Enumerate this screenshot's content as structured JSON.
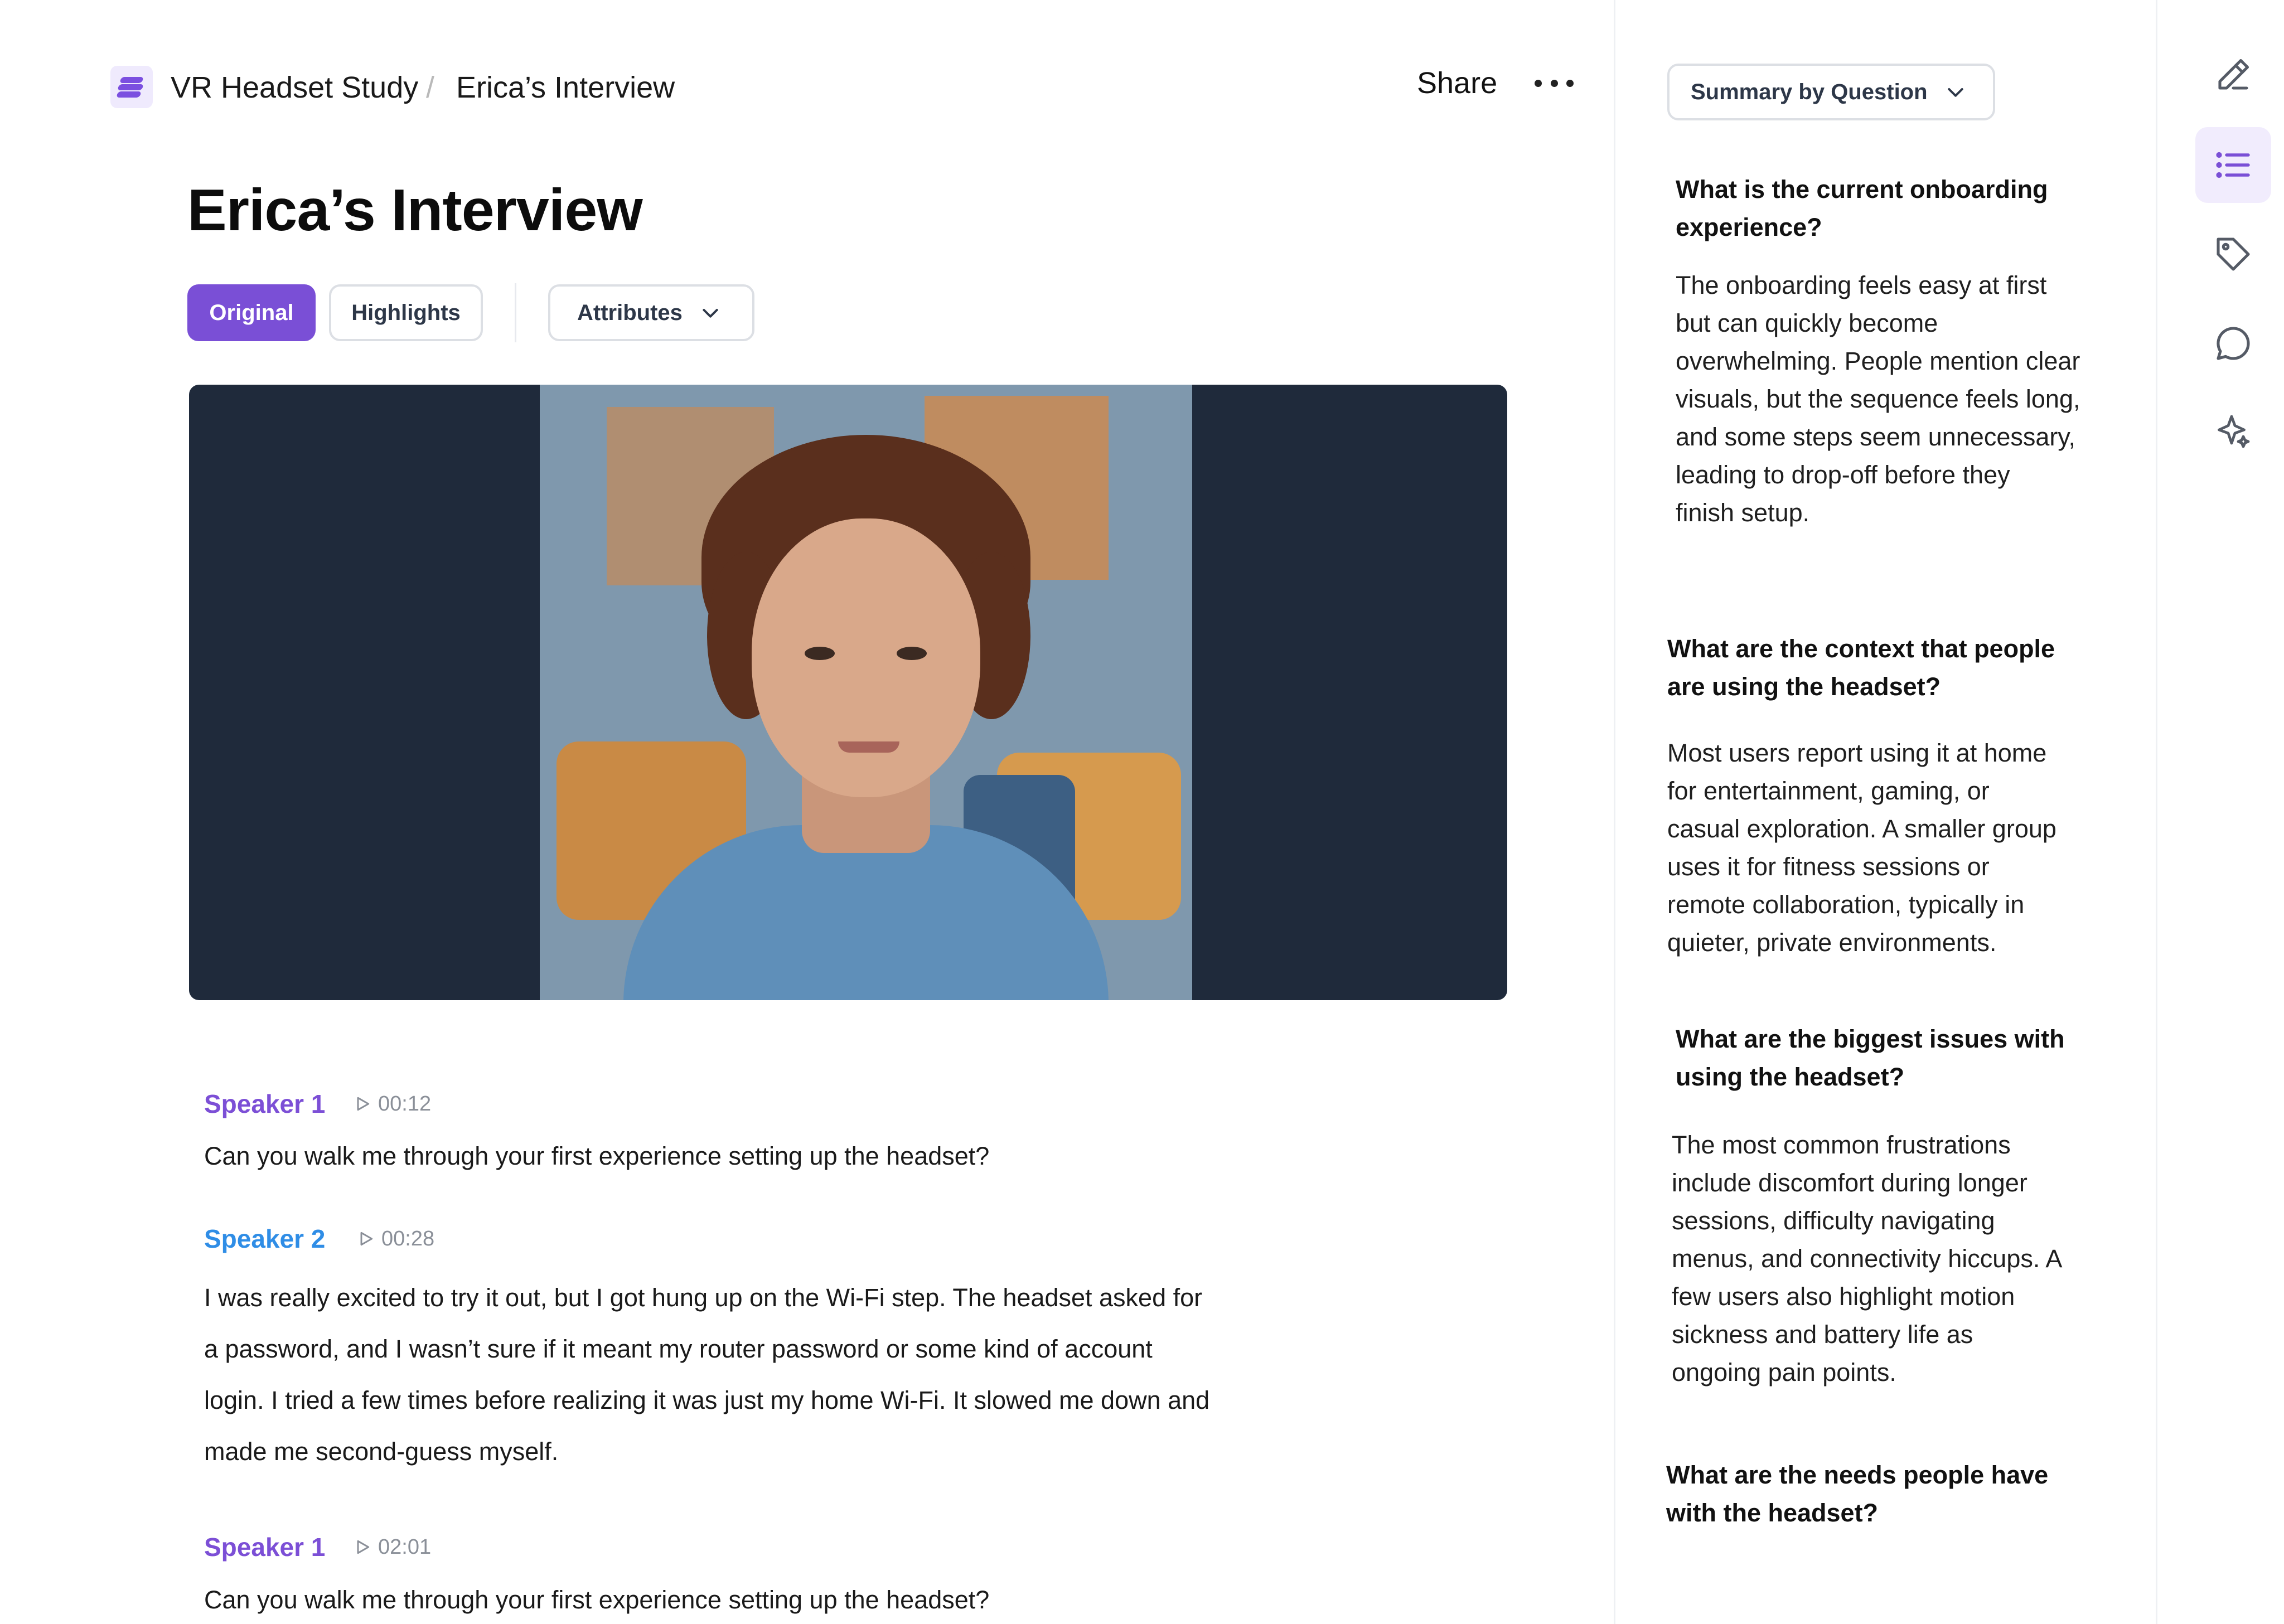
{
  "breadcrumb": {
    "project": "VR Headset Study",
    "separator": "/",
    "page": "Erica’s Interview"
  },
  "header": {
    "share_label": "Share"
  },
  "page_title": "Erica’s Interview",
  "view_tabs": [
    {
      "label": "Original",
      "active": true
    },
    {
      "label": "Highlights",
      "active": false
    }
  ],
  "attributes_label": "Attributes",
  "transcript": [
    {
      "speaker": "Speaker 1",
      "time": "00:12",
      "text": "Can you walk me through your first experience setting up the headset?"
    },
    {
      "speaker": "Speaker 2",
      "time": "00:28",
      "lines": [
        "I was really excited to try it out, but I got hung up on the Wi-Fi step. The headset asked for",
        "a password, and I wasn’t sure if it meant my router password or some kind of account",
        "login. I tried a few times before realizing it was just my home Wi-Fi. It slowed me down and",
        "made me second-guess myself."
      ]
    },
    {
      "speaker": "Speaker 1",
      "time": "02:01",
      "text": "Can you walk me through your first experience setting up the headset?"
    }
  ],
  "summary": {
    "dropdown_label": "Summary by Question",
    "questions": [
      {
        "question": [
          "What is the current onboarding",
          "experience?"
        ],
        "answer": [
          "The onboarding feels easy at first",
          "but can quickly become",
          "overwhelming. People mention clear",
          "visuals, but the sequence feels long,",
          "and some steps seem unnecessary,",
          "leading to drop-off before they",
          "finish setup."
        ]
      },
      {
        "question": [
          "What are the context that people",
          "are using the headset?"
        ],
        "answer": [
          "Most users report using it at home",
          "for entertainment, gaming, or",
          "casual exploration. A smaller group",
          "uses it for fitness sessions or",
          "remote collaboration, typically in",
          "quieter, private environments."
        ]
      },
      {
        "question": [
          "What are the biggest issues with",
          "using the headset?"
        ],
        "answer": [
          "The most common frustrations",
          "include discomfort during longer",
          "sessions, difficulty navigating",
          "menus, and connectivity hiccups. A",
          "few users also highlight motion",
          "sickness and battery life as",
          "ongoing pain points."
        ]
      },
      {
        "question": [
          "What are the needs people have",
          "with the headset?"
        ],
        "answer": []
      }
    ]
  },
  "rail": {
    "items": [
      "pen-icon",
      "list-icon",
      "tag-icon",
      "comment-icon",
      "sparkle-icon"
    ],
    "active": "list-icon"
  },
  "colors": {
    "accent": "#7a4fd6",
    "speaker_1": "#7c4fd6",
    "speaker_2": "#2f8de6",
    "video_bg": "#1f2a3b"
  }
}
